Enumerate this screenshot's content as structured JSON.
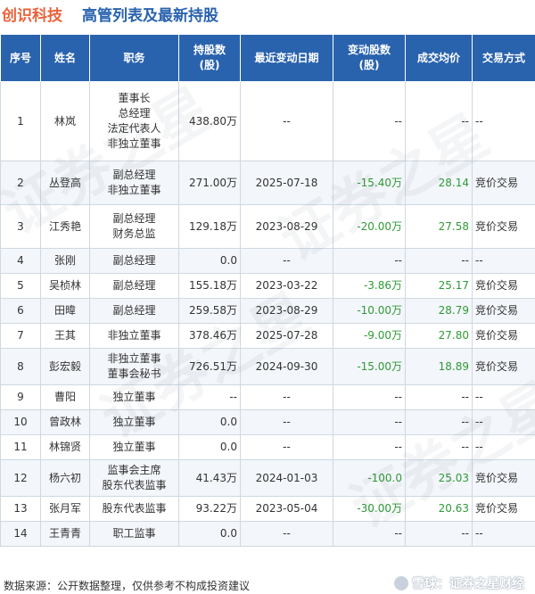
{
  "header": {
    "company": "创识科技",
    "title": "高管列表及最新持股"
  },
  "columns": [
    "序号",
    "姓名",
    "职务",
    "持股数\n(股)",
    "最近变动日期",
    "变动股数\n(股)",
    "成交均价",
    "交易方式"
  ],
  "rows": [
    {
      "no": "1",
      "name": "林岚",
      "position": [
        "董事长",
        "总经理",
        "法定代表人",
        "非独立董事"
      ],
      "shares": "438.80万",
      "date": "--",
      "change": "--",
      "price": "--",
      "mode": "--"
    },
    {
      "no": "2",
      "name": "丛登高",
      "position": [
        "副总经理",
        "非独立董事"
      ],
      "shares": "271.00万",
      "date": "2025-07-18",
      "change": "-15.40万",
      "price": "28.14",
      "mode": "竞价交易"
    },
    {
      "no": "3",
      "name": "江秀艳",
      "position": [
        "副总经理",
        "财务总监"
      ],
      "shares": "129.18万",
      "date": "2023-08-29",
      "change": "-20.00万",
      "price": "27.58",
      "mode": "竞价交易"
    },
    {
      "no": "4",
      "name": "张刚",
      "position": [
        "副总经理"
      ],
      "shares": "0.0",
      "date": "--",
      "change": "--",
      "price": "--",
      "mode": "--"
    },
    {
      "no": "5",
      "name": "吴桢林",
      "position": [
        "副总经理"
      ],
      "shares": "155.18万",
      "date": "2023-03-22",
      "change": "-3.86万",
      "price": "25.17",
      "mode": "竞价交易"
    },
    {
      "no": "6",
      "name": "田暐",
      "position": [
        "副总经理"
      ],
      "shares": "259.58万",
      "date": "2023-08-29",
      "change": "-10.00万",
      "price": "28.79",
      "mode": "竞价交易"
    },
    {
      "no": "7",
      "name": "王其",
      "position": [
        "非独立董事"
      ],
      "shares": "378.46万",
      "date": "2025-07-28",
      "change": "-9.00万",
      "price": "27.80",
      "mode": "竞价交易"
    },
    {
      "no": "8",
      "name": "彭宏毅",
      "position": [
        "非独立董事",
        "董事会秘书"
      ],
      "shares": "726.51万",
      "date": "2024-09-30",
      "change": "-15.00万",
      "price": "18.89",
      "mode": "竞价交易"
    },
    {
      "no": "9",
      "name": "曹阳",
      "position": [
        "独立董事"
      ],
      "shares": "--",
      "date": "--",
      "change": "--",
      "price": "--",
      "mode": "--"
    },
    {
      "no": "10",
      "name": "曾政林",
      "position": [
        "独立董事"
      ],
      "shares": "0.0",
      "date": "--",
      "change": "--",
      "price": "--",
      "mode": "--"
    },
    {
      "no": "11",
      "name": "林锦贤",
      "position": [
        "独立董事"
      ],
      "shares": "0.0",
      "date": "--",
      "change": "--",
      "price": "--",
      "mode": "--"
    },
    {
      "no": "12",
      "name": "杨六初",
      "position": [
        "监事会主席",
        "股东代表监事"
      ],
      "shares": "41.43万",
      "date": "2024-01-03",
      "change": "-100.0",
      "price": "25.03",
      "mode": "竞价交易"
    },
    {
      "no": "13",
      "name": "张月军",
      "position": [
        "股东代表监事"
      ],
      "shares": "93.22万",
      "date": "2023-05-04",
      "change": "-30.00万",
      "price": "20.63",
      "mode": "竞价交易"
    },
    {
      "no": "14",
      "name": "王青青",
      "position": [
        "职工监事"
      ],
      "shares": "0.0",
      "date": "--",
      "change": "--",
      "price": "--",
      "mode": "--"
    }
  ],
  "footer": {
    "source": "数据来源：公开数据整理，仅供参考不构成投资建议",
    "brand": "雪球：证券之星财经"
  },
  "watermark": "证券之星",
  "colors": {
    "header_bg": "#2a63ad",
    "company": "#e8623a",
    "title": "#2a63ad",
    "negative_change": "#2f9a36"
  },
  "icons": {
    "brand_logo": "snowball-logo-icon"
  }
}
